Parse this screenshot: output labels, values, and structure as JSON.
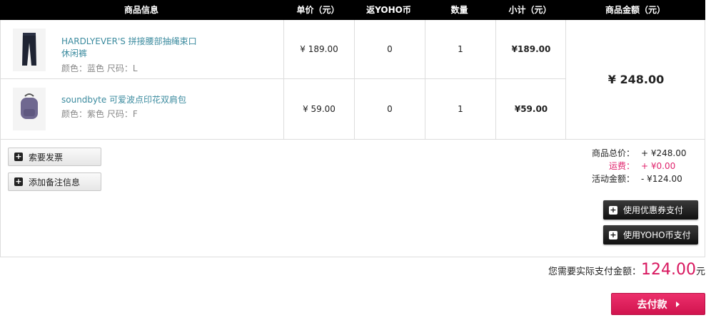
{
  "header": {
    "product_info": "商品信息",
    "unit_price": "单价（元）",
    "yoho_coin": "返YOHO币",
    "quantity": "数量",
    "subtotal": "小计（元）",
    "goods_amount": "商品金额（元）"
  },
  "items": [
    {
      "name_line1": "HARDLYEVER'S 拼接腰部抽绳束口",
      "name_line2": "休闲裤",
      "attrs": "颜色：蓝色 尺码：L",
      "unit_price": "¥ 189.00",
      "coin": "0",
      "qty": "1",
      "subtotal": "¥189.00",
      "thumb_icon": "pants-icon",
      "thumb_color": "#1f2433"
    },
    {
      "name_line1": "soundbyte 可爱波点印花双肩包",
      "name_line2": "",
      "attrs": "颜色：紫色 尺码：F",
      "unit_price": "¥ 59.00",
      "coin": "0",
      "qty": "1",
      "subtotal": "¥59.00",
      "thumb_icon": "backpack-icon",
      "thumb_color": "#6f6890"
    }
  ],
  "goods_total": "¥ 248.00",
  "actions": {
    "invoice": "索要发票",
    "remark": "添加备注信息",
    "coupon": "使用优惠券支付",
    "yoho_pay": "使用YOHO币支付"
  },
  "summary": {
    "goods_label": "商品总价：",
    "goods_value": "+ ¥248.00",
    "shipping_label": "运费：",
    "shipping_value": "+ ¥0.00",
    "promo_label": "活动金额：",
    "promo_value": "- ¥124.00"
  },
  "payment": {
    "label": "您需要实际支付金额：",
    "amount": "124.00",
    "unit": "元",
    "button": "去付款"
  },
  "colors": {
    "accent": "#d8175f",
    "link": "#3a8a9e"
  }
}
